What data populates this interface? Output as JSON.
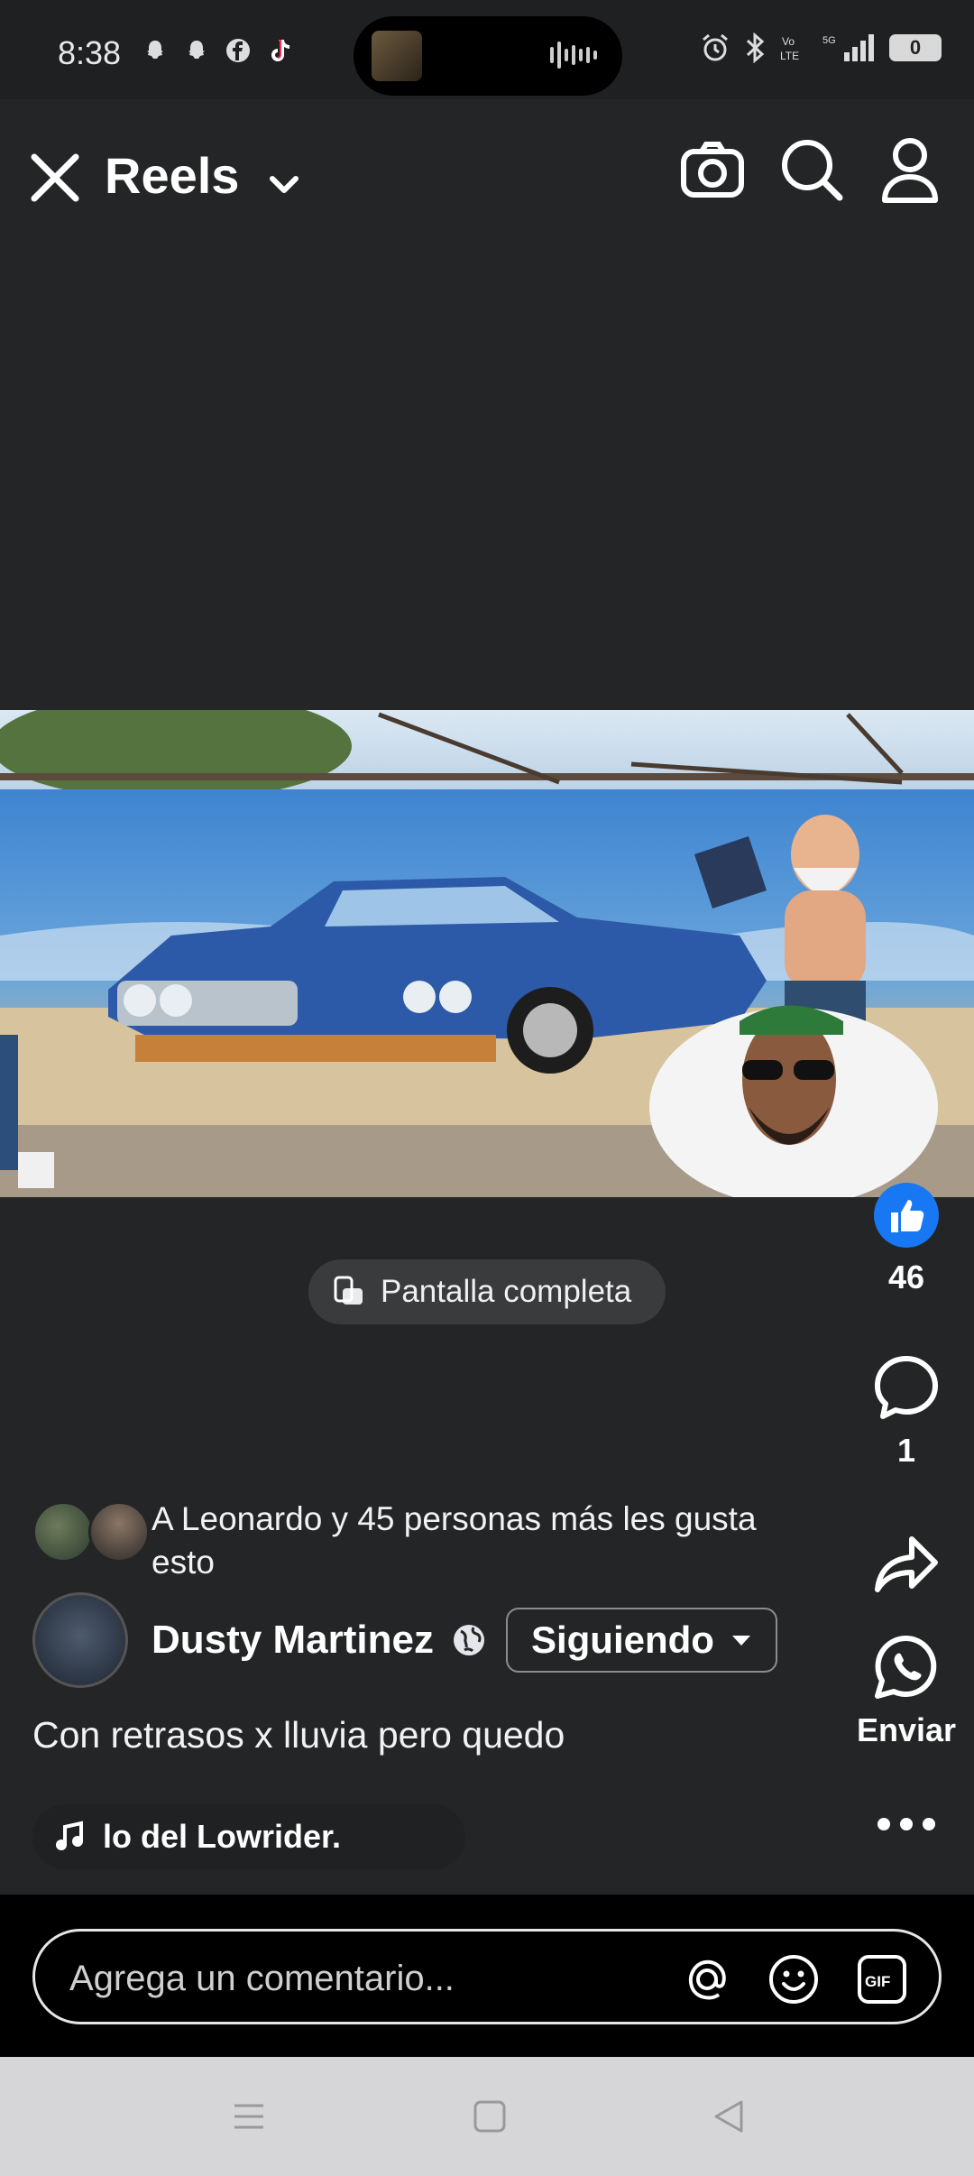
{
  "status_bar": {
    "time": "8:38",
    "battery": "0",
    "icons": [
      "snapchat-icon",
      "snapchat-icon",
      "facebook-icon",
      "tiktok-icon",
      "alarm-icon",
      "bluetooth-icon",
      "volte-icon",
      "5g-signal-icon"
    ]
  },
  "header": {
    "title": "Reels"
  },
  "video": {
    "fullscreen_label": "Pantalla completa"
  },
  "rail": {
    "like_count": "46",
    "comment_count": "1",
    "share_label": "Enviar"
  },
  "post": {
    "likes_text": "A Leonardo y 45 personas más les gusta esto",
    "author": "Dusty Martinez",
    "follow_label": "Siguiendo",
    "caption": "Con retrasos x lluvia pero quedo",
    "music": "lo del Lowrider."
  },
  "comment": {
    "placeholder": "Agrega un comentario..."
  },
  "colors": {
    "background": "#242526",
    "like_blue": "#1877f2"
  }
}
